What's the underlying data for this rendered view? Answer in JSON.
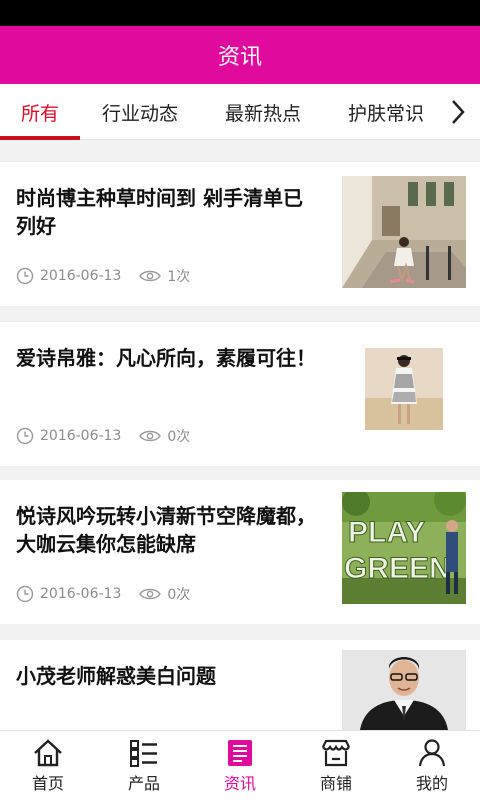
{
  "header": {
    "title": "资讯"
  },
  "tabs": [
    {
      "label": "所有",
      "active": true
    },
    {
      "label": "行业动态",
      "active": false
    },
    {
      "label": "最新热点",
      "active": false
    },
    {
      "label": "护肤常识",
      "active": false
    }
  ],
  "articles": [
    {
      "title": "时尚博主种草时间到 剁手清单已列好",
      "date": "2016-06-13",
      "views": "1次"
    },
    {
      "title": "爱诗帛雅：凡心所向，素履可往！",
      "date": "2016-06-13",
      "views": "0次"
    },
    {
      "title": "悦诗风吟玩转小清新节空降魔都，大咖云集你怎能缺席",
      "date": "2016-06-13",
      "views": "0次"
    },
    {
      "title": "小茂老师解惑美白问题",
      "date": "",
      "views": ""
    }
  ],
  "thumb_text": {
    "line1": "PLAY",
    "line2": "GREEN"
  },
  "nav": [
    {
      "label": "首页",
      "icon": "home-icon",
      "active": false
    },
    {
      "label": "产品",
      "icon": "list-icon",
      "active": false
    },
    {
      "label": "资讯",
      "icon": "news-icon",
      "active": true
    },
    {
      "label": "商铺",
      "icon": "shop-icon",
      "active": false
    },
    {
      "label": "我的",
      "icon": "user-icon",
      "active": false
    }
  ],
  "colors": {
    "brand": "#e00a9c",
    "tab_active": "#e00a2a",
    "meta": "#8c8c8c"
  }
}
